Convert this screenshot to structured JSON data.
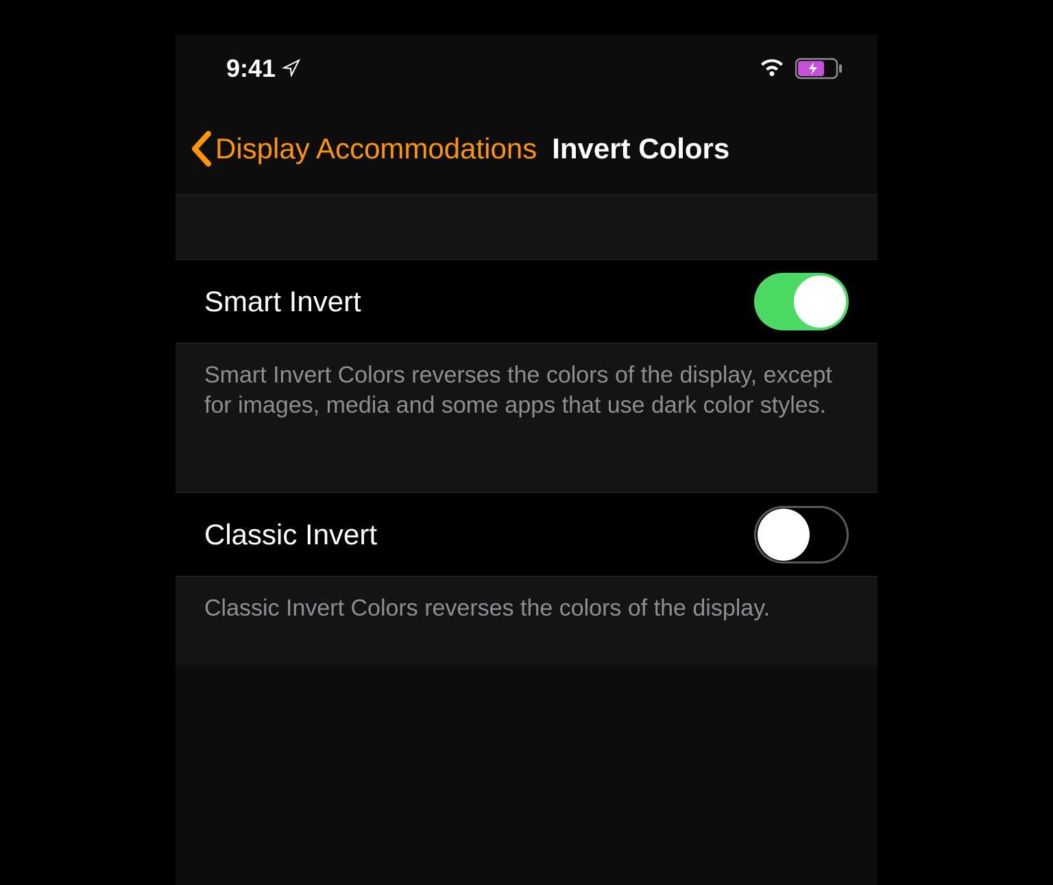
{
  "status_bar": {
    "time": "9:41"
  },
  "nav": {
    "back_label": "Display Accommodations",
    "title": "Invert Colors"
  },
  "settings": {
    "smart_invert": {
      "label": "Smart Invert",
      "enabled": true,
      "description": "Smart Invert Colors reverses the colors of the display, except for images, media and some apps that use dark color styles."
    },
    "classic_invert": {
      "label": "Classic Invert",
      "enabled": false,
      "description": "Classic Invert Colors reverses the colors of the display."
    }
  },
  "colors": {
    "accent": "#ff9500",
    "toggle_on": "#4cd964",
    "battery_fill": "#c84fd9"
  }
}
